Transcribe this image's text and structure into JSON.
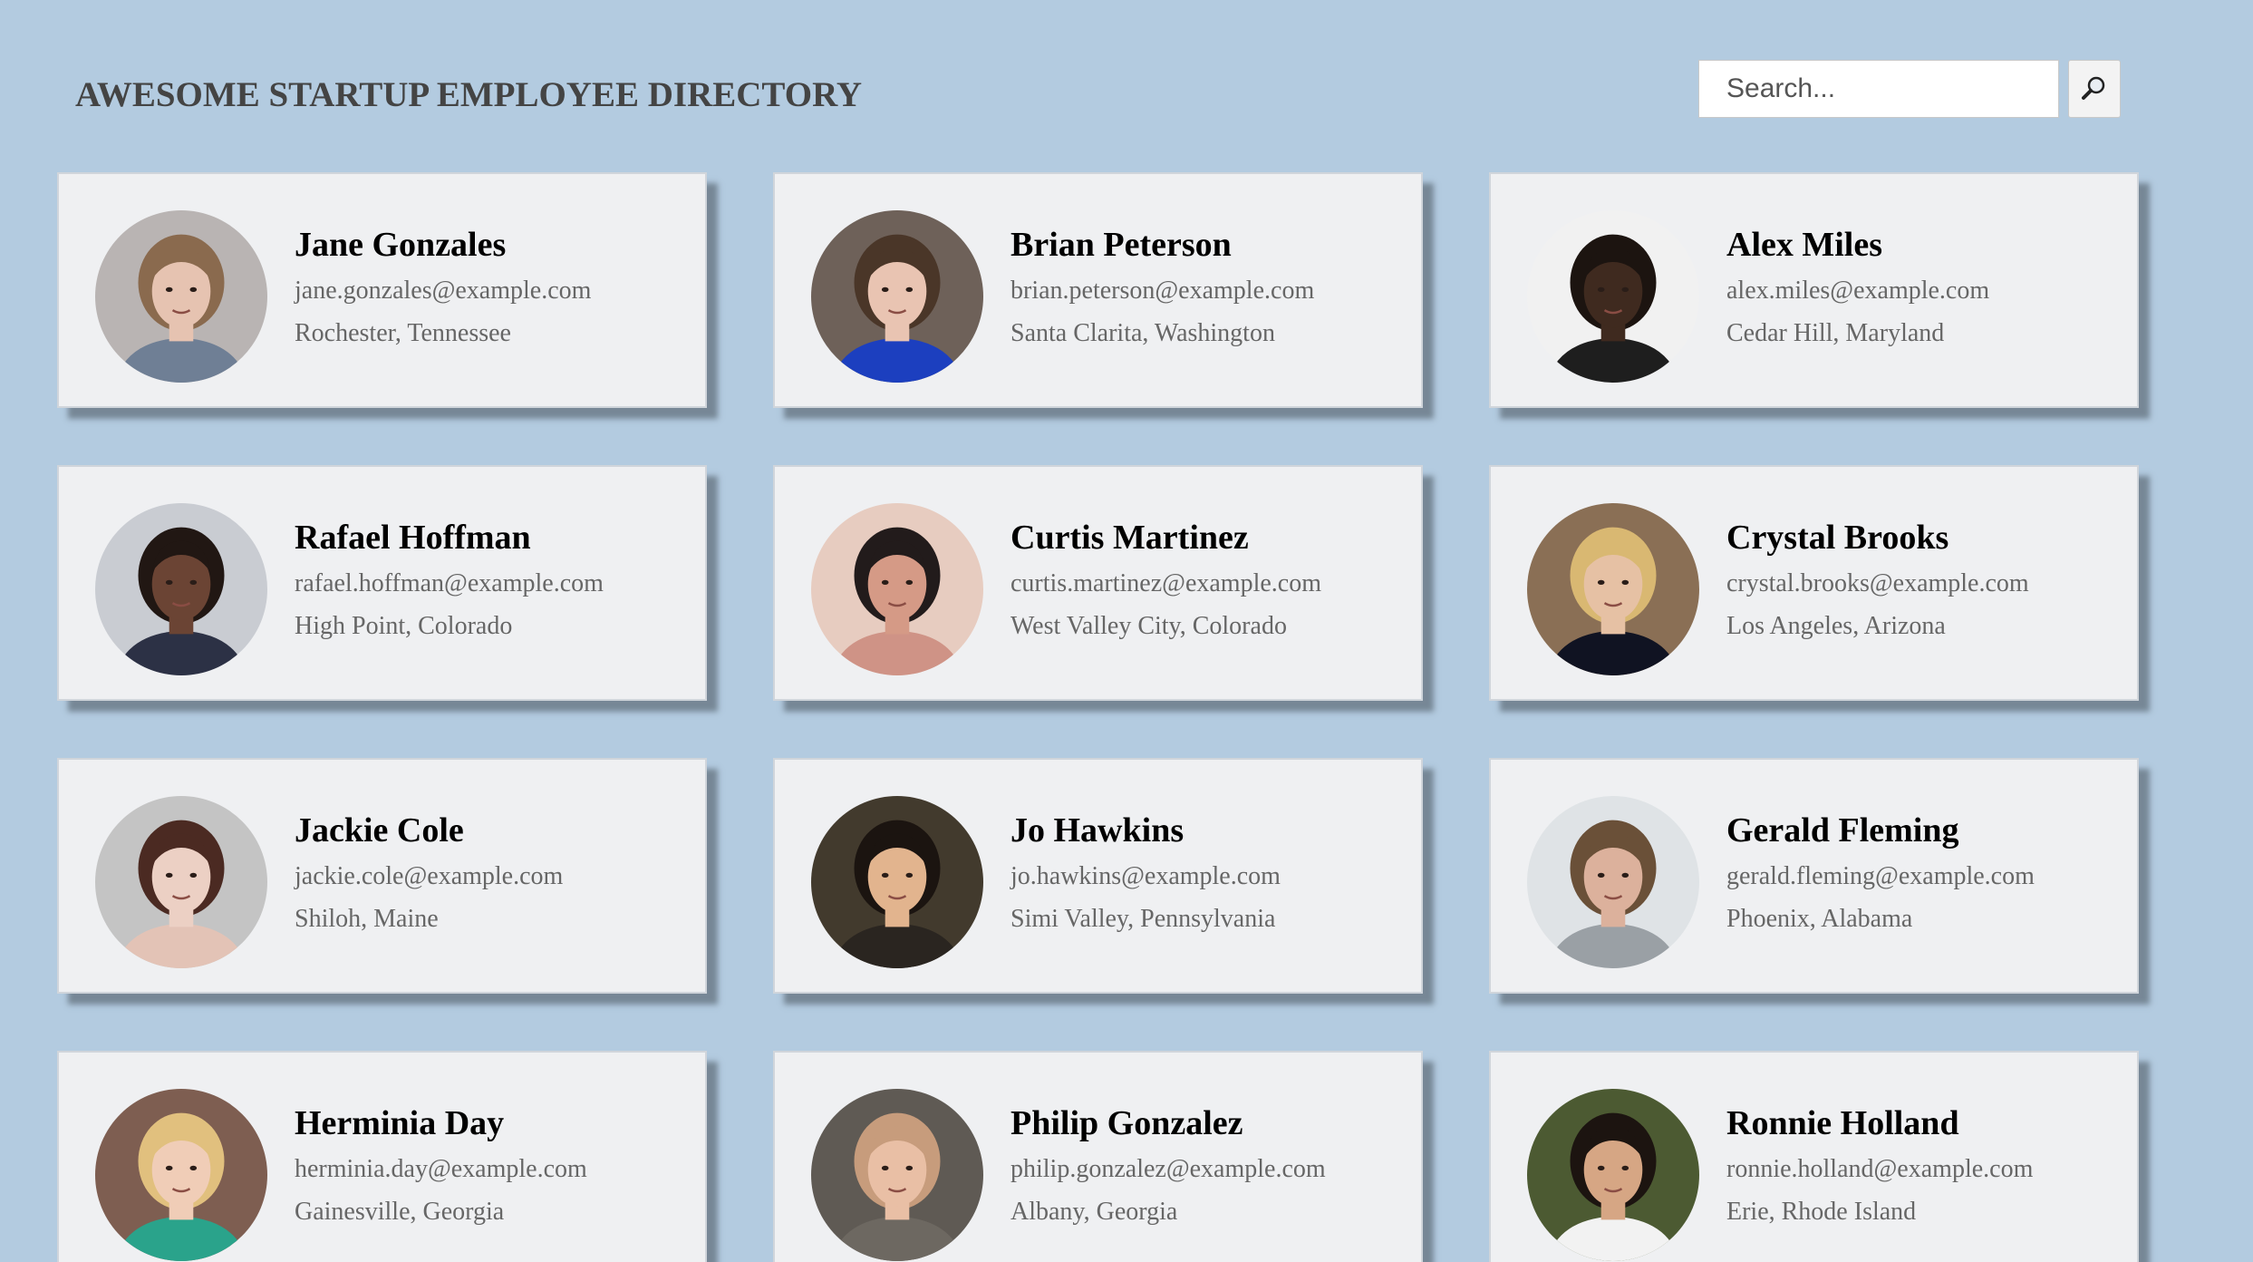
{
  "header": {
    "title": "AWESOME STARTUP EMPLOYEE DIRECTORY"
  },
  "search": {
    "placeholder": "Search...",
    "value": "",
    "button_icon": "search-icon"
  },
  "colors": {
    "background": "#b3cbe0",
    "card": "#eff0f2"
  },
  "employees": [
    {
      "name": "Jane Gonzales",
      "email": "jane.gonzales@example.com",
      "location": "Rochester, Tennessee",
      "photo": {
        "bg": "#b9b4b3",
        "skin": "#e6c3b1",
        "hair": "#8a6a4e",
        "shirt": "#6f7f95"
      }
    },
    {
      "name": "Brian Peterson",
      "email": "brian.peterson@example.com",
      "location": "Santa Clarita, Washington",
      "photo": {
        "bg": "#6e6159",
        "skin": "#e9c4b2",
        "hair": "#4a3628",
        "shirt": "#1c3fbf"
      }
    },
    {
      "name": "Alex Miles",
      "email": "alex.miles@example.com",
      "location": "Cedar Hill, Maryland",
      "photo": {
        "bg": "#f1f1f1",
        "skin": "#3f2a1f",
        "hair": "#1c1410",
        "shirt": "#1e1e1e"
      }
    },
    {
      "name": "Rafael Hoffman",
      "email": "rafael.hoffman@example.com",
      "location": "High Point, Colorado",
      "photo": {
        "bg": "#c9ccd2",
        "skin": "#6b4434",
        "hair": "#211713",
        "shirt": "#2c3145"
      }
    },
    {
      "name": "Curtis Martinez",
      "email": "curtis.martinez@example.com",
      "location": "West Valley City, Colorado",
      "photo": {
        "bg": "#e7ccc0",
        "skin": "#d59a86",
        "hair": "#221b1b",
        "shirt": "#cf9386"
      }
    },
    {
      "name": "Crystal Brooks",
      "email": "crystal.brooks@example.com",
      "location": "Los Angeles, Arizona",
      "photo": {
        "bg": "#8a6f55",
        "skin": "#e6c1a4",
        "hair": "#d9b872",
        "shirt": "#101322"
      }
    },
    {
      "name": "Jackie Cole",
      "email": "jackie.cole@example.com",
      "location": "Shiloh, Maine",
      "photo": {
        "bg": "#c4c4c4",
        "skin": "#ecd0c4",
        "hair": "#4b2a22",
        "shirt": "#e3c3b6"
      }
    },
    {
      "name": "Jo Hawkins",
      "email": "jo.hawkins@example.com",
      "location": "Simi Valley, Pennsylvania",
      "photo": {
        "bg": "#423a2d",
        "skin": "#e2b48e",
        "hair": "#1b1410",
        "shirt": "#2a2520"
      }
    },
    {
      "name": "Gerald Fleming",
      "email": "gerald.fleming@example.com",
      "location": "Phoenix, Alabama",
      "photo": {
        "bg": "#dfe3e6",
        "skin": "#dcb19c",
        "hair": "#6a5038",
        "shirt": "#9aa0a5"
      }
    },
    {
      "name": "Herminia Day",
      "email": "herminia.day@example.com",
      "location": "Gainesville, Georgia",
      "photo": {
        "bg": "#7e5e51",
        "skin": "#f0cdb7",
        "hair": "#e1c07e",
        "shirt": "#2aa38b"
      }
    },
    {
      "name": "Philip Gonzalez",
      "email": "philip.gonzalez@example.com",
      "location": "Albany, Georgia",
      "photo": {
        "bg": "#5f5a54",
        "skin": "#e9bfa5",
        "hair": "#c79c7c",
        "shirt": "#6d6861"
      }
    },
    {
      "name": "Ronnie Holland",
      "email": "ronnie.holland@example.com",
      "location": "Erie, Rhode Island",
      "photo": {
        "bg": "#4c5a32",
        "skin": "#d6a684",
        "hair": "#1c1410",
        "shirt": "#f2f2f2"
      }
    }
  ]
}
